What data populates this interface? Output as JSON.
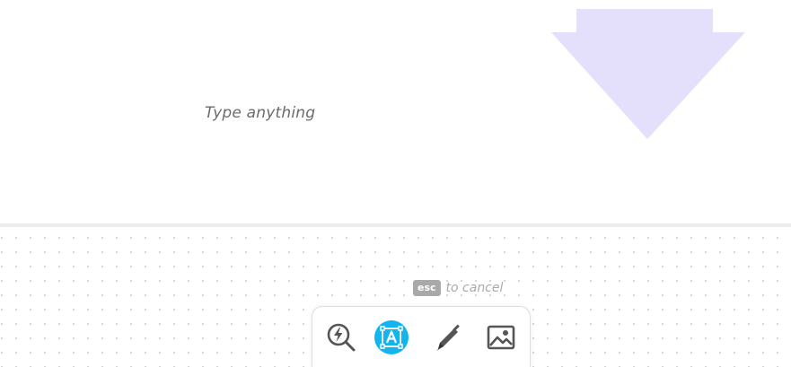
{
  "canvas": {
    "placeholder": "Type anything",
    "arrow_color": "#e4e0fb"
  },
  "hint": {
    "key": "esc",
    "text": "to cancel"
  },
  "toolbar": {
    "tools": [
      {
        "icon": "quick-search-icon",
        "active": false
      },
      {
        "icon": "text-tool-icon",
        "active": true
      },
      {
        "icon": "pen-icon",
        "active": false
      },
      {
        "icon": "image-icon",
        "active": false
      }
    ],
    "accent_color": "#12b5ef"
  }
}
